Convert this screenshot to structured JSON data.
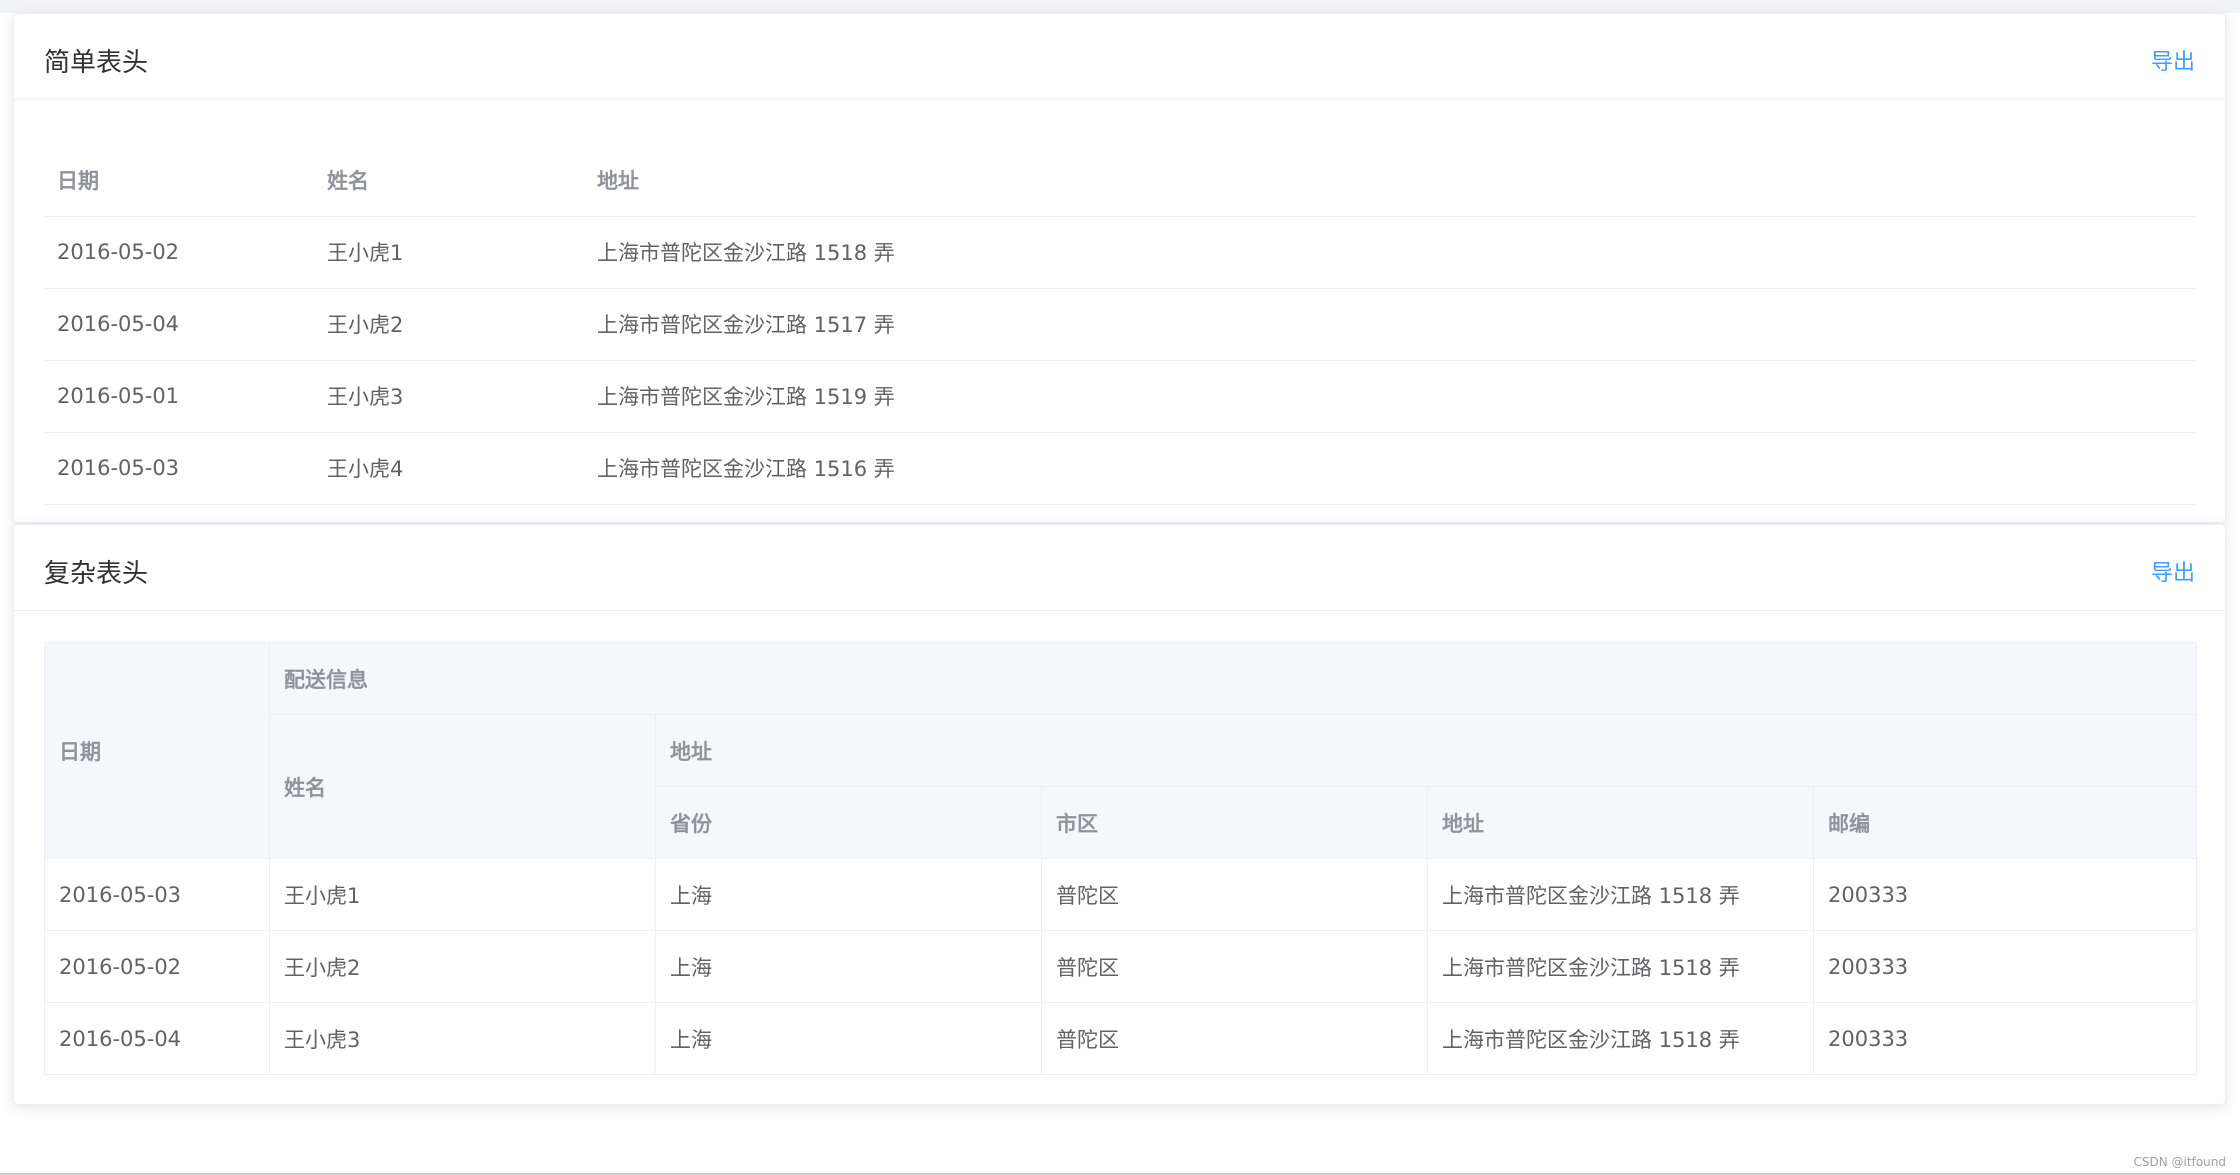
{
  "simple_section": {
    "title": "简单表头",
    "export_label": "导出",
    "columns": [
      "日期",
      "姓名",
      "地址"
    ],
    "rows": [
      [
        "2016-05-02",
        "王小虎1",
        "上海市普陀区金沙江路 1518 弄"
      ],
      [
        "2016-05-04",
        "王小虎2",
        "上海市普陀区金沙江路 1517 弄"
      ],
      [
        "2016-05-01",
        "王小虎3",
        "上海市普陀区金沙江路 1519 弄"
      ],
      [
        "2016-05-03",
        "王小虎4",
        "上海市普陀区金沙江路 1516 弄"
      ]
    ]
  },
  "complex_section": {
    "title": "复杂表头",
    "export_label": "导出",
    "header": {
      "date": "日期",
      "delivery": "配送信息",
      "name": "姓名",
      "address_group": "地址",
      "province": "省份",
      "city": "市区",
      "address": "地址",
      "zip": "邮编"
    },
    "rows": [
      [
        "2016-05-03",
        "王小虎1",
        "上海",
        "普陀区",
        "上海市普陀区金沙江路 1518 弄",
        "200333"
      ],
      [
        "2016-05-02",
        "王小虎2",
        "上海",
        "普陀区",
        "上海市普陀区金沙江路 1518 弄",
        "200333"
      ],
      [
        "2016-05-04",
        "王小虎3",
        "上海",
        "普陀区",
        "上海市普陀区金沙江路 1518 弄",
        "200333"
      ]
    ]
  },
  "watermark": "CSDN @itfound"
}
